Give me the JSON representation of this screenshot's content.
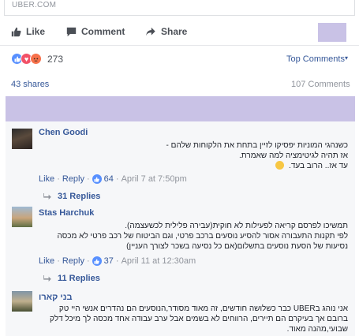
{
  "link_preview": {
    "domain": "UBER.COM"
  },
  "actions": {
    "like": "Like",
    "comment": "Comment",
    "share": "Share"
  },
  "reactions": {
    "count": "273",
    "icons": [
      "like-icon",
      "love-icon",
      "angry-icon"
    ],
    "top_comments": "Top Comments"
  },
  "stats": {
    "shares": "43 shares",
    "comments": "107 Comments"
  },
  "colors": {
    "link_blue": "#365899",
    "redaction": "#c9c2e6",
    "comment_bg": "#f6f7f9"
  },
  "comments": [
    {
      "author": "Chen Goodi",
      "lines": [
        "כשנהגי המוניות יפסיקו לזיין בתחת את הלקוחות שלהם -",
        "אז תהיה לגיטימציה למה שאמרת.",
        "עד אז.. הרוב בעד."
      ],
      "like": "Like",
      "reply": "Reply",
      "likes": "64",
      "time": "April 7 at 7:50pm",
      "replies": "31 Replies"
    },
    {
      "author": "Stas Harchuk",
      "lines": [
        "תמשיכו לפרסם קריאה לפעילות לא חוקית(עבירה פלילית לכשעצמה).",
        "לפי תקנות התעבורה אסור להסיע נוסעים ברכב פרטי, וגם הביטוח של רכב פרטי לא מכסה",
        "נסיעות של הסעת נוסעים בתשלום(אם כל נסיעה בשכר לצורך העניין)"
      ],
      "like": "Like",
      "reply": "Reply",
      "likes": "37",
      "time": "April 11 at 12:30am",
      "replies": "11 Replies"
    },
    {
      "author": "בני קארו",
      "lines": [
        "אני נוהג בUBER כבר כשלושה חודשים, זה מאוד מסודר,הנוסעים הם נהדרים אנשי היי טק",
        "ברובם אך בעיקרם הם תיירים, הרווחים לא בשמים אבל ערב עבודה אחד מכסה לך מיכל דלק",
        "שבועי,מהנה מאוד."
      ]
    }
  ]
}
